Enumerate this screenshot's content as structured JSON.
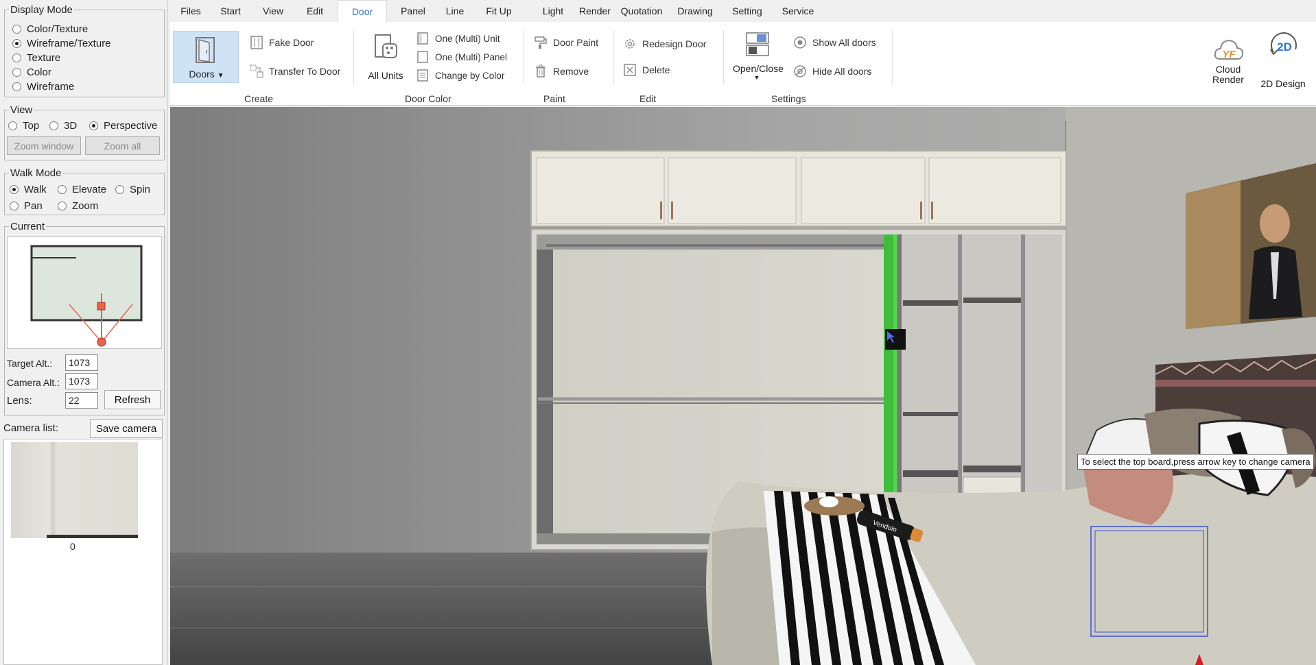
{
  "left_panel": {
    "display_mode": {
      "legend": "Display Mode",
      "options": [
        "Color/Texture",
        "Wireframe/Texture",
        "Texture",
        "Color",
        "Wireframe"
      ],
      "selected": "Wireframe/Texture"
    },
    "view": {
      "legend": "View",
      "options": [
        "Top",
        "3D",
        "Perspective"
      ],
      "selected": "Perspective",
      "zoom_window": "Zoom window",
      "zoom_all": "Zoom all"
    },
    "walk_mode": {
      "legend": "Walk Mode",
      "options": [
        "Walk",
        "Elevate",
        "Spin",
        "Pan",
        "Zoom"
      ],
      "selected": "Walk"
    },
    "current": {
      "legend": "Current",
      "target_alt_label": "Target Alt.:",
      "target_alt_value": "1073",
      "camera_alt_label": "Camera Alt.:",
      "camera_alt_value": "1073",
      "lens_label": "Lens:",
      "lens_value": "22",
      "refresh": "Refresh"
    },
    "camera_list": {
      "label": "Camera list:",
      "save_button": "Save camera",
      "thumb_caption": "0"
    }
  },
  "ribbon": {
    "tabs": [
      "Files",
      "Start",
      "View",
      "Edit",
      "Door",
      "Panel",
      "Line",
      "Fit Up",
      "Light",
      "Render",
      "Quotation",
      "Drawing",
      "Setting",
      "Service"
    ],
    "active_tab": "Door",
    "create": {
      "doors": "Doors",
      "fake_door": "Fake Door",
      "transfer_to_door": "Transfer To Door",
      "group_label": "Create"
    },
    "door_color": {
      "all_units": "All Units",
      "one_multi_unit": "One (Multi) Unit",
      "one_multi_panel": "One (Multi) Panel",
      "change_by_color": "Change by Color",
      "group_label": "Door Color"
    },
    "paint": {
      "door_paint": "Door Paint",
      "remove": "Remove",
      "group_label": "Paint"
    },
    "edit": {
      "redesign_door": "Redesign Door",
      "delete": "Delete",
      "group_label": "Edit"
    },
    "settings": {
      "open_close": "Open/Close",
      "show_all_doors": "Show All doors",
      "hide_all_doors": "Hide All doors",
      "group_label": "Settings"
    },
    "right": {
      "cloud_render_line1": "Cloud",
      "cloud_render_line2": "Render",
      "cloud_logo": "YF",
      "design_2d": "2D Design",
      "design_2d_logo": "2D"
    }
  },
  "viewport": {
    "tooltip": "To select the top board,press arrow key to change camera",
    "bottle_text": "Vendolo"
  },
  "colors": {
    "accent": "#2e74d6",
    "selection_green": "#3dbd3a",
    "wall": "#9b9b9b",
    "floor": "#5a5a5a"
  }
}
